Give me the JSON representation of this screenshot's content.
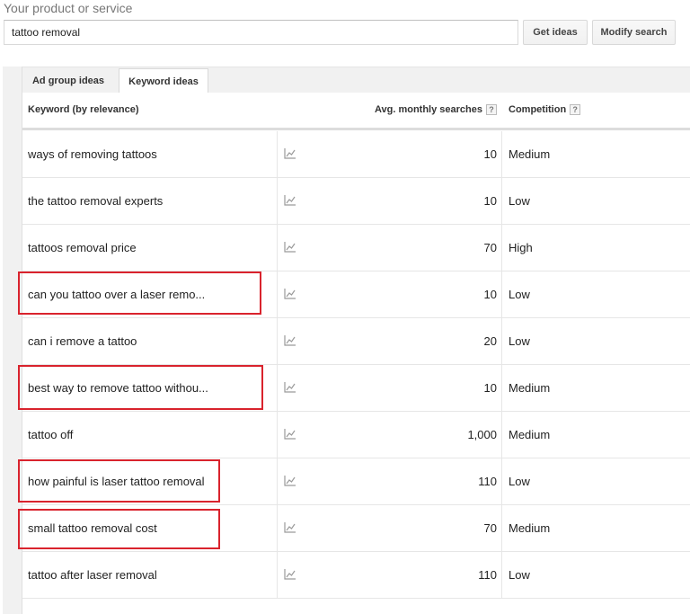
{
  "search": {
    "label": "Your product or service",
    "value": "tattoo removal",
    "get_ideas": "Get ideas",
    "modify_search": "Modify search"
  },
  "tabs": [
    {
      "label": "Ad group ideas",
      "active": false
    },
    {
      "label": "Keyword ideas",
      "active": true
    }
  ],
  "table": {
    "columns": {
      "keyword": "Keyword (by relevance)",
      "avg": "Avg. monthly searches",
      "competition": "Competition",
      "help": "?"
    },
    "rows": [
      {
        "keyword": "ways of removing tattoos",
        "avg": "10",
        "competition": "Medium",
        "highlighted": false
      },
      {
        "keyword": "the tattoo removal experts",
        "avg": "10",
        "competition": "Low",
        "highlighted": false
      },
      {
        "keyword": "tattoos removal price",
        "avg": "70",
        "competition": "High",
        "highlighted": false
      },
      {
        "keyword": "can you tattoo over a laser remo...",
        "avg": "10",
        "competition": "Low",
        "highlighted": true
      },
      {
        "keyword": "can i remove a tattoo",
        "avg": "20",
        "competition": "Low",
        "highlighted": false
      },
      {
        "keyword": "best way to remove tattoo withou...",
        "avg": "10",
        "competition": "Medium",
        "highlighted": true
      },
      {
        "keyword": "tattoo off",
        "avg": "1,000",
        "competition": "Medium",
        "highlighted": false
      },
      {
        "keyword": "how painful is laser tattoo removal",
        "avg": "110",
        "competition": "Low",
        "highlighted": true
      },
      {
        "keyword": "small tattoo removal cost",
        "avg": "70",
        "competition": "Medium",
        "highlighted": true
      },
      {
        "keyword": "tattoo after laser removal",
        "avg": "110",
        "competition": "Low",
        "highlighted": false
      }
    ]
  },
  "colors": {
    "highlight": "#d9232d",
    "tab_band": "#f1f1f1"
  },
  "icons": {
    "trend": "trend-chart-icon"
  }
}
